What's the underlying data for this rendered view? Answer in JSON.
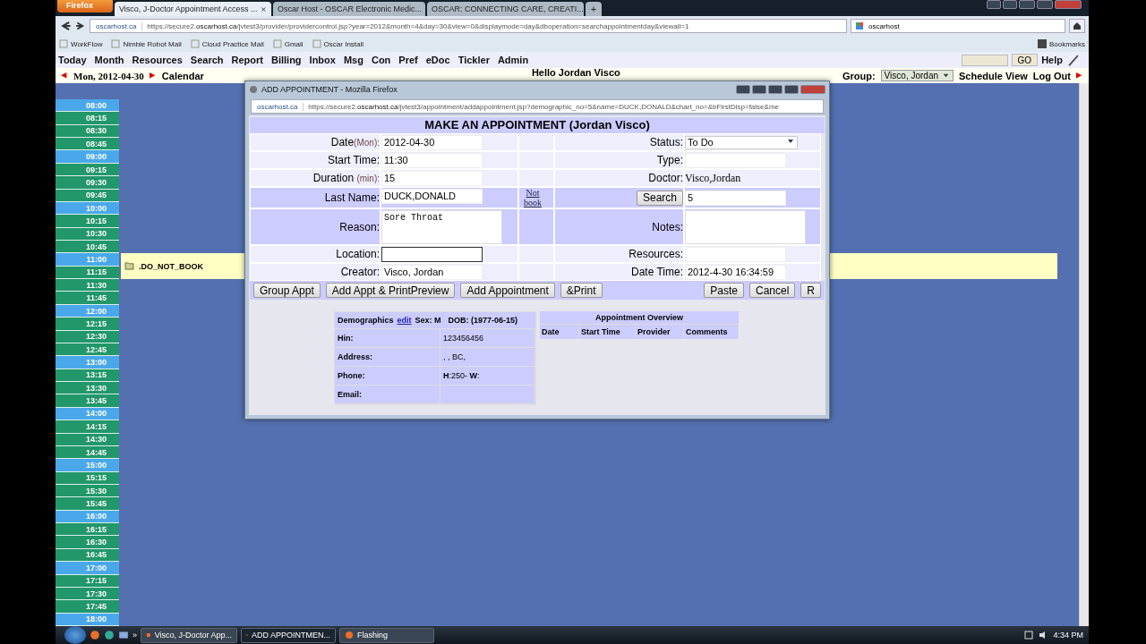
{
  "browser": {
    "menu_button": "Firefox",
    "tabs": [
      {
        "title": "Visco, J-Doctor Appointment Access ...",
        "selected": true
      },
      {
        "title": "Oscar Host - OSCAR Electronic Medic...",
        "selected": false
      },
      {
        "title": "OSCAR: CONNECTING CARE, CREATI...",
        "selected": false
      }
    ],
    "new_tab": "+",
    "url_site": "oscarhost.ca",
    "url": "https://secure2.**oscarhost.ca**/jvtest3/provider/providercontrol.jsp?year=2012&month=4&day=30&view=0&displaymode=day&dboperation=searchappointmentday&viewall=1",
    "search": "oscarhost",
    "bookmarks": [
      "WorkFlow",
      "Nimble Robot Mail",
      "Cloud Practice Mail",
      "Gmail",
      "Oscar Install"
    ],
    "bookmarks_menu": "Bookmarks"
  },
  "app": {
    "menu": [
      "Today",
      "Month",
      "Resources",
      "Search",
      "Report",
      "Billing",
      "Inbox",
      "Msg",
      "Con",
      "Pref",
      "eDoc",
      "Tickler",
      "Admin"
    ],
    "go_button": "GO",
    "help": "Help",
    "date": "Mon, 2012-04-30",
    "calendar": "Calendar",
    "greeting": "Hello Jordan Visco",
    "group_label": "Group:",
    "group": "Visco, Jordan",
    "schedule_view": "Schedule View",
    "logout": "Log Out"
  },
  "schedule": {
    "slots": [
      {
        "time": "08:00",
        "kind": "hour"
      },
      {
        "time": "08:15",
        "kind": "quarter"
      },
      {
        "time": "08:30",
        "kind": "quarter"
      },
      {
        "time": "08:45",
        "kind": "quarter"
      },
      {
        "time": "09:00",
        "kind": "hour"
      },
      {
        "time": "09:15",
        "kind": "quarter"
      },
      {
        "time": "09:30",
        "kind": "quarter"
      },
      {
        "time": "09:45",
        "kind": "quarter"
      },
      {
        "time": "10:00",
        "kind": "hour"
      },
      {
        "time": "10:15",
        "kind": "quarter"
      },
      {
        "time": "10:30",
        "kind": "quarter"
      },
      {
        "time": "10:45",
        "kind": "quarter"
      },
      {
        "time": "11:00",
        "kind": "hour",
        "appointment": ".DO_NOT_BOOK"
      },
      {
        "time": "11:15",
        "kind": "quarter"
      },
      {
        "time": "11:30",
        "kind": "quarter"
      },
      {
        "time": "11:45",
        "kind": "quarter"
      },
      {
        "time": "12:00",
        "kind": "hour"
      },
      {
        "time": "12:15",
        "kind": "quarter"
      },
      {
        "time": "12:30",
        "kind": "quarter"
      },
      {
        "time": "12:45",
        "kind": "quarter"
      },
      {
        "time": "13:00",
        "kind": "hour"
      },
      {
        "time": "13:15",
        "kind": "quarter"
      },
      {
        "time": "13:30",
        "kind": "quarter"
      },
      {
        "time": "13:45",
        "kind": "quarter"
      },
      {
        "time": "14:00",
        "kind": "hour"
      },
      {
        "time": "14:15",
        "kind": "quarter"
      },
      {
        "time": "14:30",
        "kind": "quarter"
      },
      {
        "time": "14:45",
        "kind": "quarter"
      },
      {
        "time": "15:00",
        "kind": "hour"
      },
      {
        "time": "15:15",
        "kind": "quarter"
      },
      {
        "time": "15:30",
        "kind": "quarter"
      },
      {
        "time": "15:45",
        "kind": "quarter"
      },
      {
        "time": "16:00",
        "kind": "hour"
      },
      {
        "time": "16:15",
        "kind": "quarter"
      },
      {
        "time": "16:30",
        "kind": "quarter"
      },
      {
        "time": "16:45",
        "kind": "quarter"
      },
      {
        "time": "17:00",
        "kind": "hour"
      },
      {
        "time": "17:15",
        "kind": "quarter"
      },
      {
        "time": "17:30",
        "kind": "quarter"
      },
      {
        "time": "17:45",
        "kind": "quarter"
      },
      {
        "time": "18:00",
        "kind": "hour"
      }
    ]
  },
  "dialog": {
    "title": "ADD APPOINTMENT - Mozilla Firefox",
    "url_site": "oscarhost.ca",
    "url": "https://secure2.**oscarhost.ca**/jvtest3/appointment/addappointment.jsp?demographic_no=5&name=DUCK,DONALD&chart_no=&bFirstDisp=false&me",
    "heading": "MAKE AN APPOINTMENT (Jordan Visco)",
    "rows": [
      {
        "highlight": false,
        "left": {
          "label": "Date",
          "note": "(Mon):",
          "value": "2012-04-30",
          "kind": "input",
          "focused": false
        },
        "right": {
          "label": "Status:",
          "value": "To Do",
          "kind": "select",
          "focused": false
        }
      },
      {
        "highlight": false,
        "left": {
          "label": "Start Time:",
          "value": "11:30",
          "kind": "input",
          "focused": false
        },
        "right": {
          "label": "Type:",
          "kind": "input",
          "focused": false
        }
      },
      {
        "highlight": false,
        "left": {
          "label": "Duration ",
          "note": "(min):",
          "value": "15",
          "kind": "input",
          "focused": false
        },
        "right": {
          "label": "Doctor:",
          "value": "Visco,Jordan",
          "kind": "text",
          "focused": false
        }
      },
      {
        "highlight": true,
        "left": {
          "label": "Last Name:",
          "value": "DUCK,DONALD",
          "kind": "input",
          "focused": false
        },
        "link": "Not book",
        "right": {
          "button": "Search",
          "value": "5",
          "kind": "input",
          "focused": false
        }
      },
      {
        "highlight": true,
        "left": {
          "label": "Reason:",
          "value": "Sore Throat",
          "kind": "textarea",
          "focused": false
        },
        "right": {
          "label": "Notes:",
          "kind": "textarea",
          "focused": false
        }
      },
      {
        "highlight": false,
        "left": {
          "label": "Location:",
          "kind": "input",
          "focused": true
        },
        "right": {
          "label": "Resources:",
          "kind": "input",
          "focused": false
        }
      },
      {
        "highlight": false,
        "left": {
          "label": "Creator:",
          "value": "Visco, Jordan",
          "kind": "input",
          "focused": false
        },
        "right": {
          "label": "Date Time:",
          "value": "2012-4-30 16:34:59",
          "kind": "input",
          "focused": false
        }
      }
    ],
    "buttons_left": [
      "Group Appt",
      "Add Appt & PrintPreview",
      "Add Appointment",
      "&Print"
    ],
    "buttons_right": [
      "Paste",
      "Cancel",
      "R"
    ],
    "demographics": {
      "title": "Demographics",
      "edit": "edit",
      "sex": "Sex: M",
      "dob": "DOB: (1977-06-15)",
      "rows": [
        {
          "label": "Hin:",
          "value": "123456456"
        },
        {
          "label": "Address:",
          "value": ", , BC,"
        },
        {
          "label": "Phone:",
          "value": "**H**:250- **W**:"
        },
        {
          "label": "Email:"
        }
      ]
    },
    "overview": {
      "title": "Appointment Overview",
      "columns": [
        "Date",
        "Start Time",
        "Provider",
        "Comments"
      ]
    }
  },
  "taskbar": {
    "items": [
      {
        "title": "Visco, J-Doctor App...",
        "selected": false
      },
      {
        "title": "ADD APPOINTMEN...",
        "selected": true
      },
      {
        "title": "Flashing",
        "selected": false
      }
    ],
    "more": "»",
    "clock": "4:34 PM"
  }
}
